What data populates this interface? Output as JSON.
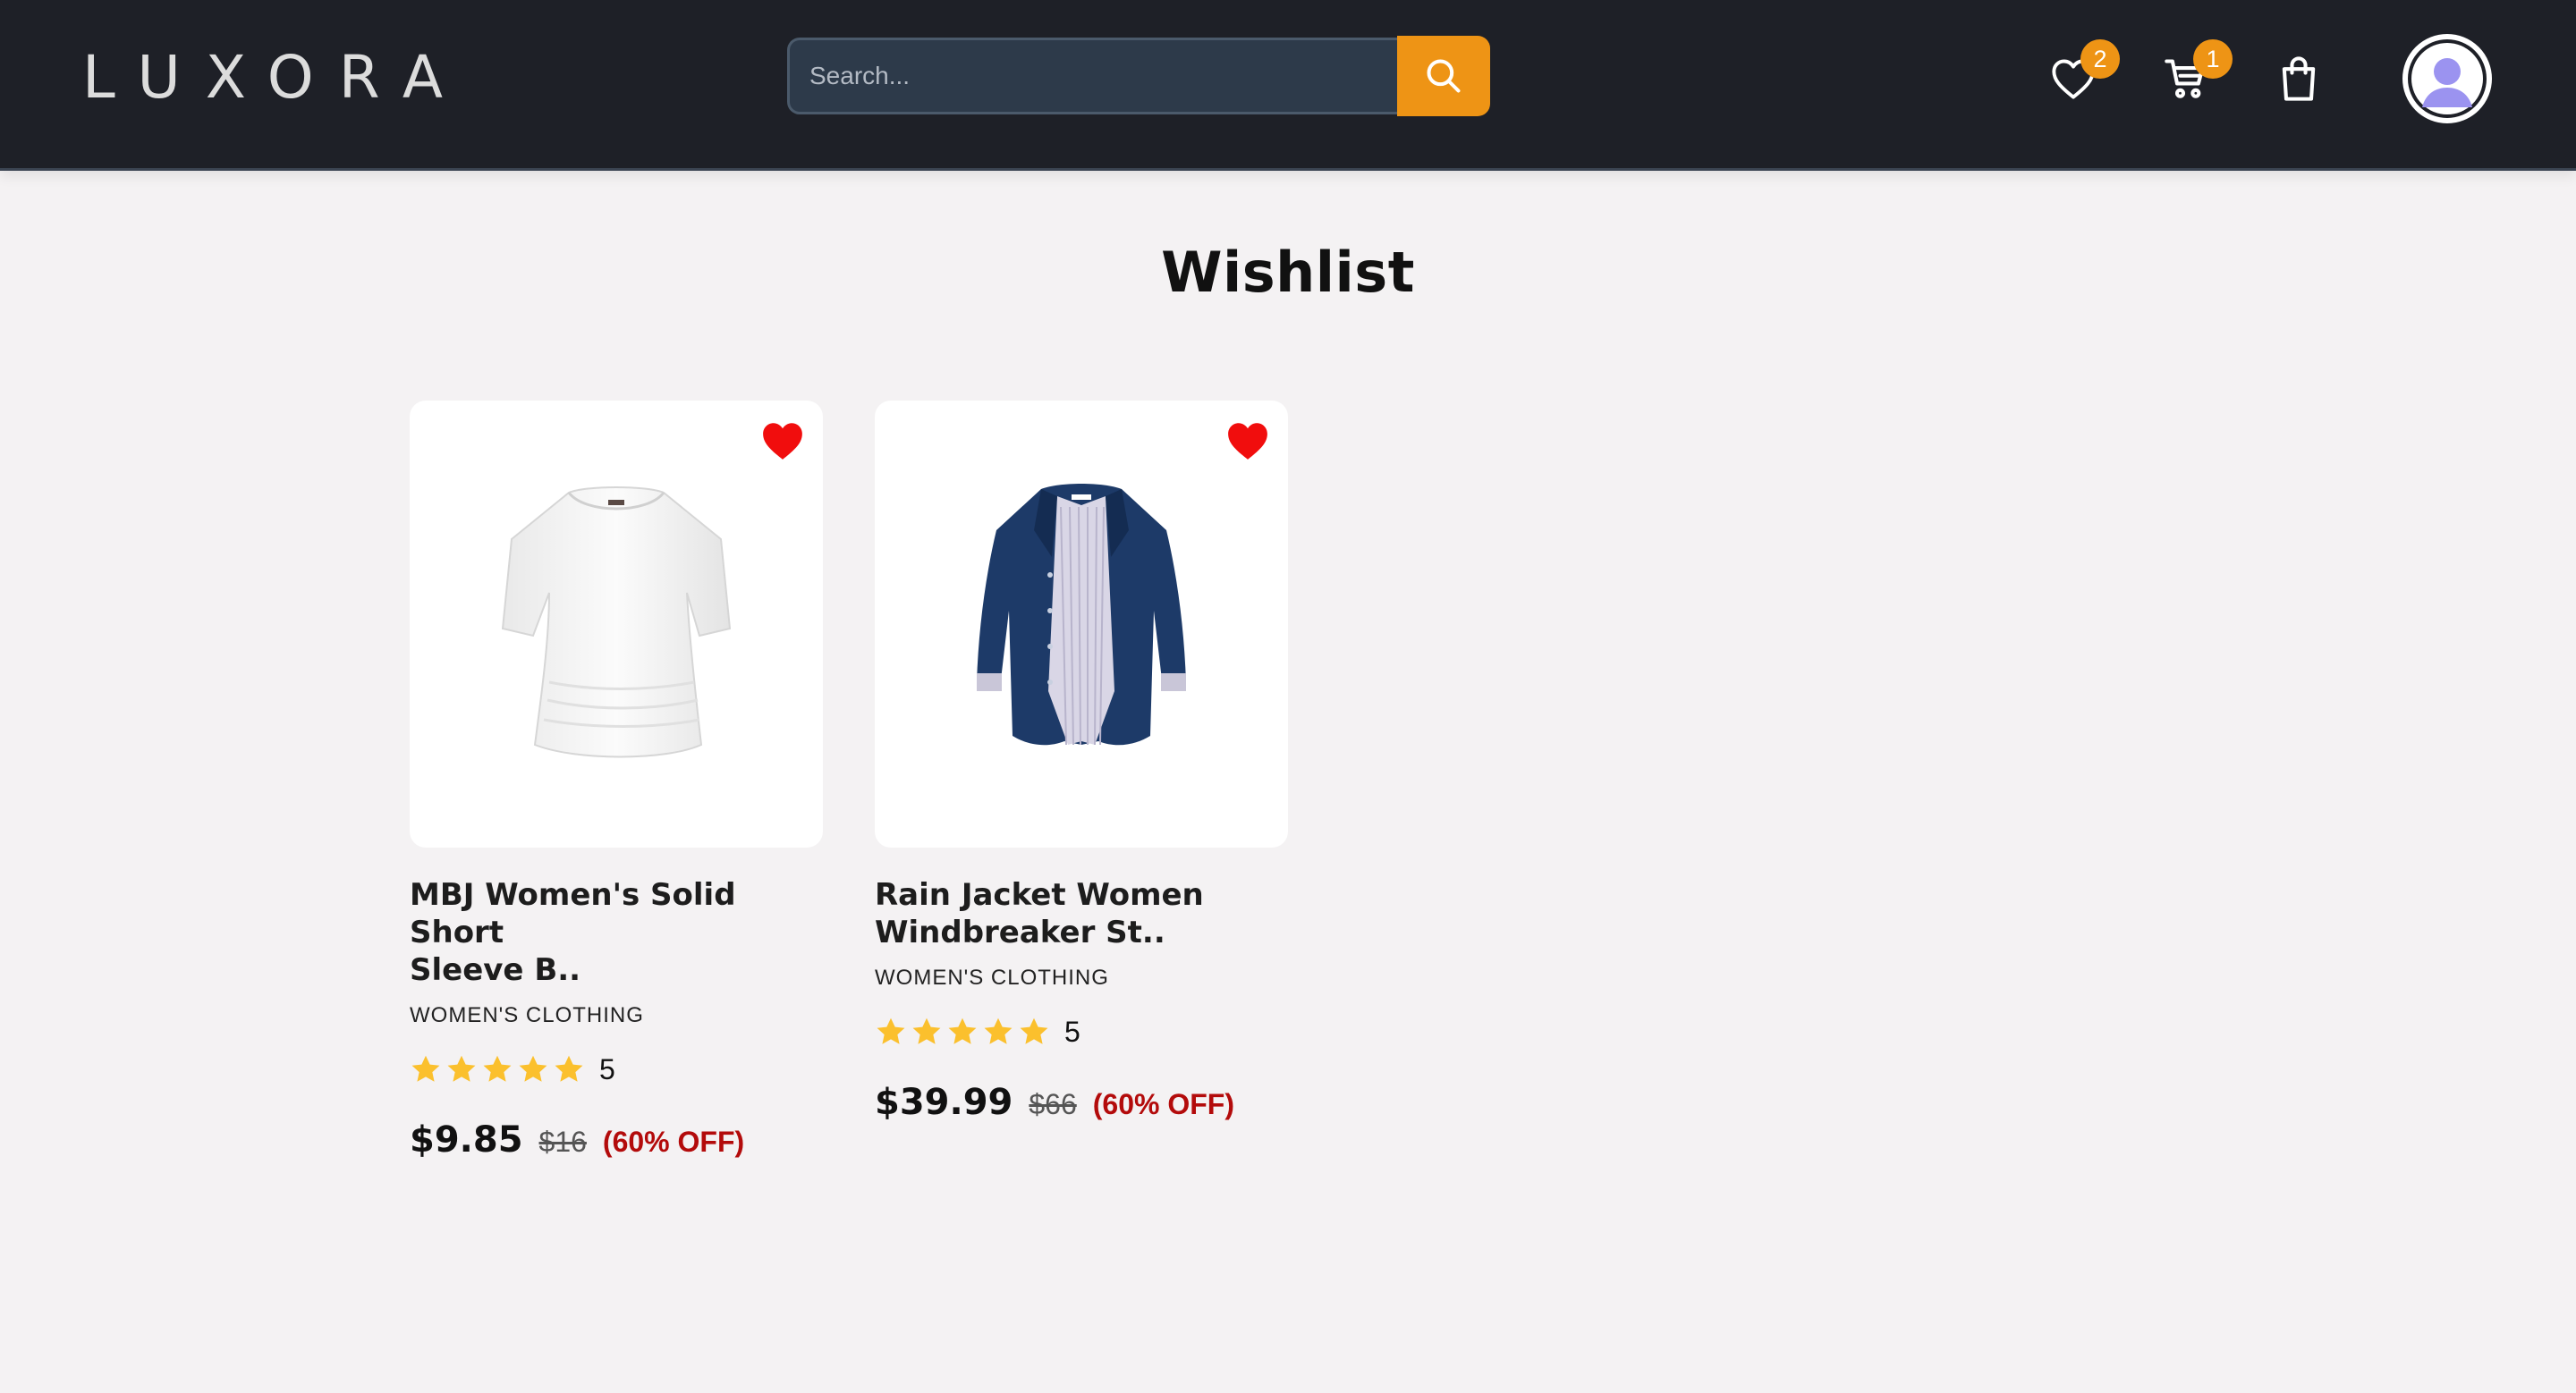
{
  "header": {
    "logo_text": "LUXORA",
    "search": {
      "placeholder": "Search..."
    },
    "wishlist_count": "2",
    "cart_count": "1"
  },
  "page": {
    "title": "Wishlist"
  },
  "products": [
    {
      "name_line1": "MBJ Women's Solid Short",
      "name_line2": "Sleeve B..",
      "category": "WOMEN'S CLOTHING",
      "rating": "5",
      "price": "$9.85",
      "old_price": "$16",
      "discount": "(60% OFF)",
      "image": "white-tshirt"
    },
    {
      "name_line1": "Rain Jacket Women",
      "name_line2": "Windbreaker St..",
      "category": "WOMEN'S CLOTHING",
      "rating": "5",
      "price": "$39.99",
      "old_price": "$66",
      "discount": "(60% OFF)",
      "image": "navy-rain-jacket"
    }
  ],
  "colors": {
    "header_bg": "#1e2027",
    "accent": "#ee9415",
    "favorite": "#f10d0d",
    "discount": "#b30b0b",
    "star": "#fbc02d"
  }
}
